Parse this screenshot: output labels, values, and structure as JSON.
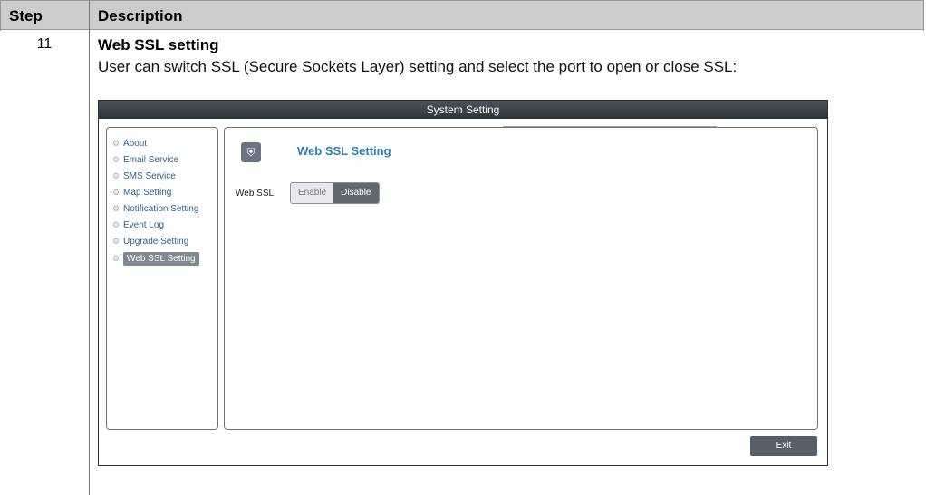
{
  "table": {
    "headers": {
      "step": "Step",
      "description": "Description"
    },
    "row": {
      "step": "11",
      "title": "Web SSL setting",
      "text": "User can switch SSL (Secure Sockets Layer) setting and select the port to open or close SSL:"
    }
  },
  "window": {
    "title": "System Setting",
    "sidebar": [
      {
        "label": "About"
      },
      {
        "label": "Email Service"
      },
      {
        "label": "SMS Service"
      },
      {
        "label": "Map Setting"
      },
      {
        "label": "Notification Setting"
      },
      {
        "label": "Event Log"
      },
      {
        "label": "Upgrade Setting"
      },
      {
        "label": "Web SSL Setting",
        "active": true
      }
    ],
    "content": {
      "title": "Web SSL Setting",
      "field_label": "Web SSL:",
      "options": [
        {
          "label": "Enable",
          "selected": false
        },
        {
          "label": "Disable",
          "selected": true
        }
      ]
    },
    "exit_label": "Exit"
  }
}
